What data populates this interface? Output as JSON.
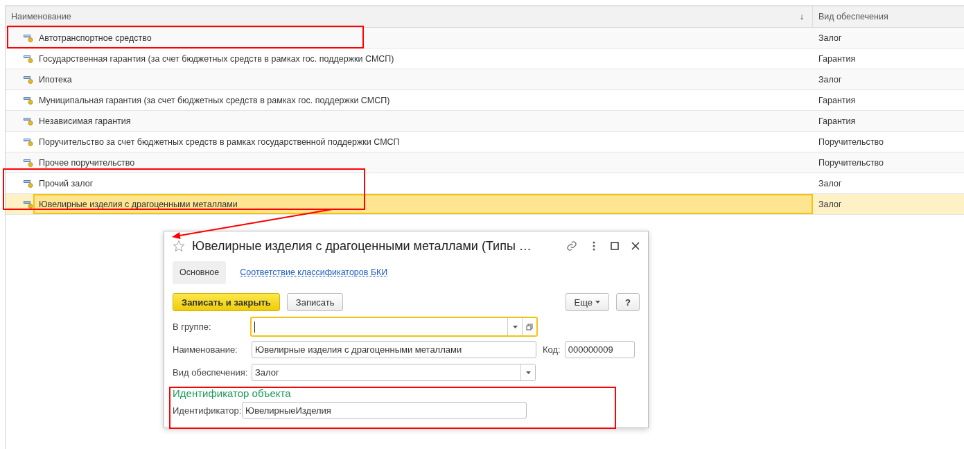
{
  "table": {
    "columns": [
      {
        "label": "Наименование",
        "sort_indicator": "↓"
      },
      {
        "label": "Вид обеспечения"
      }
    ],
    "rows": [
      {
        "name": "Автотранспортное средство",
        "kind_of_security": "Залог",
        "selected": false
      },
      {
        "name": "Государственная гарантия (за счет бюджетных средств в рамках гос. поддержки СМСП)",
        "kind_of_security": "Гарантия",
        "selected": false
      },
      {
        "name": "Ипотека",
        "kind_of_security": "Залог",
        "selected": false
      },
      {
        "name": "Муниципальная гарантия (за счет бюджетных средств в рамках гос. поддержки СМСП)",
        "kind_of_security": "Гарантия",
        "selected": false
      },
      {
        "name": "Независимая гарантия",
        "kind_of_security": "Гарантия",
        "selected": false
      },
      {
        "name": "Поручительство за счет бюджетных средств в рамках государственной поддержки СМСП",
        "kind_of_security": "Поручительство",
        "selected": false
      },
      {
        "name": "Прочее поручительство",
        "kind_of_security": "Поручительство",
        "selected": false
      },
      {
        "name": "Прочий залог",
        "kind_of_security": "Залог",
        "selected": false
      },
      {
        "name": "Ювелирные изделия с драгоценными металлами",
        "kind_of_security": "Залог",
        "selected": true
      }
    ]
  },
  "dialog": {
    "title": "Ювелирные изделия с драгоценными металлами (Типы …",
    "tabs": [
      {
        "label": "Основное",
        "selected": true
      },
      {
        "label": "Соответствие классификаторов БКИ",
        "selected": false
      }
    ],
    "buttons": {
      "primary": "Записать и закрыть",
      "save": "Записать",
      "more": "Еще",
      "help": "?"
    },
    "fields": {
      "group": {
        "label": "В группе:"
      },
      "name": {
        "label": "Наименование:",
        "value": "Ювелирные изделия с драгоценными металлами"
      },
      "code": {
        "label": "Код:",
        "value": "000000009"
      },
      "security_kind": {
        "label": "Вид обеспечения:",
        "value": "Залог"
      }
    },
    "section": {
      "title": "Идентификатор объекта",
      "label": "Идентификатор:",
      "value": "ЮвелирныеИзделия"
    }
  }
}
